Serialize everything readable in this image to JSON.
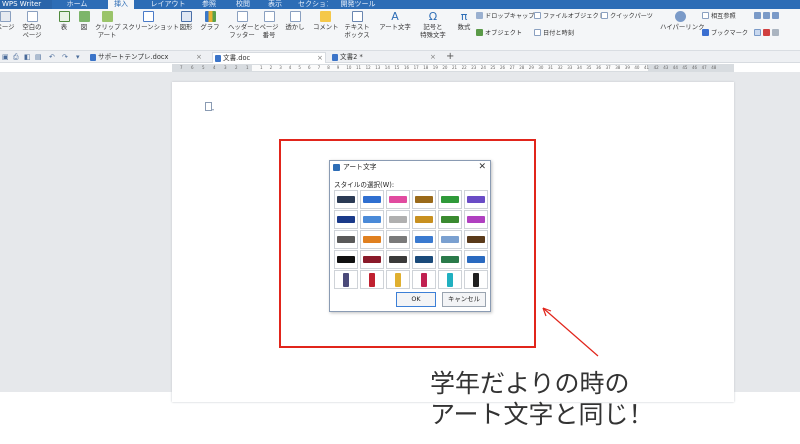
{
  "menubar": {
    "app_title": "WPS Writer",
    "tabs": [
      "ホーム",
      "挿入",
      "レイアウト",
      "参照",
      "校閲",
      "表示",
      "セクション",
      "開発ツール"
    ],
    "active_tab": "挿入"
  },
  "ribbon": {
    "page_btn": "ページ",
    "blank_page": "空白の\nページ",
    "table": "表",
    "image": "図",
    "clipart": "クリップ\nアート",
    "screenshot": "スクリーンショット",
    "shapes": "図形",
    "chart": "グラフ",
    "header_footer": "ヘッダーと\nフッター",
    "page_number": "ページ\n番号",
    "watermark": "透かし",
    "comment": "コメント",
    "textbox": "テキスト\nボックス",
    "wordart": "アート文字",
    "symbol": "記号と\n特殊文字",
    "equation": "数式",
    "dropcap": "ドロップキャップ",
    "file_object": "ファイルオブジェクト",
    "quickparts": "クイックパーツ",
    "object": "オブジェクト",
    "datetime": "日付と時刻",
    "hyperlink": "ハイパーリンク",
    "crossref": "相互参照",
    "bookmark": "ブックマーク"
  },
  "tabs": {
    "doc_tabs": [
      {
        "label": "サポートテンプレ.docx",
        "active": false
      },
      {
        "label": "文書.doc",
        "active": true
      },
      {
        "label": "文書2 *",
        "active": false
      }
    ],
    "new_tab": "+"
  },
  "ruler": {
    "left_ticks": [
      "7",
      "6",
      "5",
      "4",
      "3",
      "2",
      "1"
    ],
    "right_ticks": [
      "1",
      "2",
      "3",
      "4",
      "5",
      "6",
      "7",
      "8",
      "9",
      "10",
      "11",
      "12",
      "13",
      "14",
      "15",
      "16",
      "17",
      "18",
      "19",
      "20",
      "21",
      "22",
      "23",
      "24",
      "25",
      "26",
      "27",
      "28",
      "29",
      "30",
      "31",
      "32",
      "33",
      "34",
      "35",
      "36",
      "37",
      "38",
      "39",
      "40",
      "41",
      "42",
      "43",
      "44",
      "45",
      "46",
      "47",
      "48"
    ]
  },
  "dialog": {
    "title": "アート文字",
    "close": "✕",
    "style_label": "スタイルの選択(W):",
    "sample_text": "Kingsoft",
    "ok": "OK",
    "cancel": "キャンセル"
  },
  "styles": {
    "rows": [
      [
        "#2b3b55",
        "#2f6fd0",
        "#e14ba0",
        "#9a6a1a",
        "#2f9a3a",
        "#6a4cc6"
      ],
      [
        "#1a3a8a",
        "#4a8ad8",
        "#b0b0b0",
        "#c89020",
        "#3a8a30",
        "#b040c0"
      ],
      [
        "#5a5a5a",
        "#e08020",
        "#7a7a7a",
        "#3a7ad0",
        "#7aa0d0",
        "#5a3a1a"
      ],
      [
        "#101010",
        "#8a1a2a",
        "#3a3a3a",
        "#1a4a7a",
        "#2a7a4a",
        "#2a6ac0"
      ],
      [
        "#4a4a7a",
        "#c02030",
        "#e0b030",
        "#c02050",
        "#20b0c0",
        "#202020"
      ]
    ]
  },
  "caption": {
    "line1": "学年だよりの時の",
    "line2": "アート文字と同じ！"
  }
}
